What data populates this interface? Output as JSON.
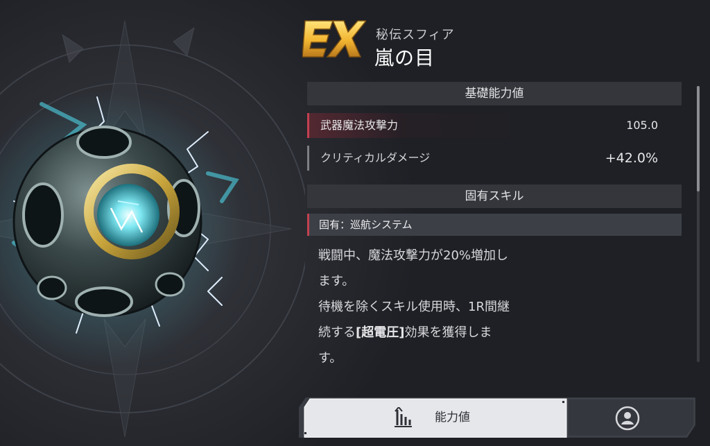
{
  "header": {
    "rank": "EX",
    "type_label": "秘伝スフィア",
    "item_name": "嵐の目"
  },
  "base_stats": {
    "title": "基礎能力値",
    "rows": [
      {
        "name": "武器魔法攻撃力",
        "value": "105.0",
        "highlight": true
      },
      {
        "name": "クリティカルダメージ",
        "value": "+42.0%",
        "highlight": false
      }
    ]
  },
  "unique_skill": {
    "title": "固有スキル",
    "skill_name": "固有：巡航システム",
    "desc_lines": [
      "戦闘中、魔法攻撃力が20%増加し",
      "ます。",
      "待機を除くスキル使用時、1R間継"
    ],
    "desc_line4_prefix": "続する",
    "desc_line4_bold": "[超電圧]",
    "desc_line4_suffix": "効果を獲得しま",
    "desc_line5": "す。"
  },
  "tabs": {
    "stats_label": "能力値",
    "stats_icon": "bar-chart-icon",
    "profile_icon": "profile-icon",
    "active": "stats"
  },
  "colors": {
    "accent_red": "#c2404f",
    "rank_gold": "#f2b531",
    "orb_glow": "#4fd3e6"
  }
}
